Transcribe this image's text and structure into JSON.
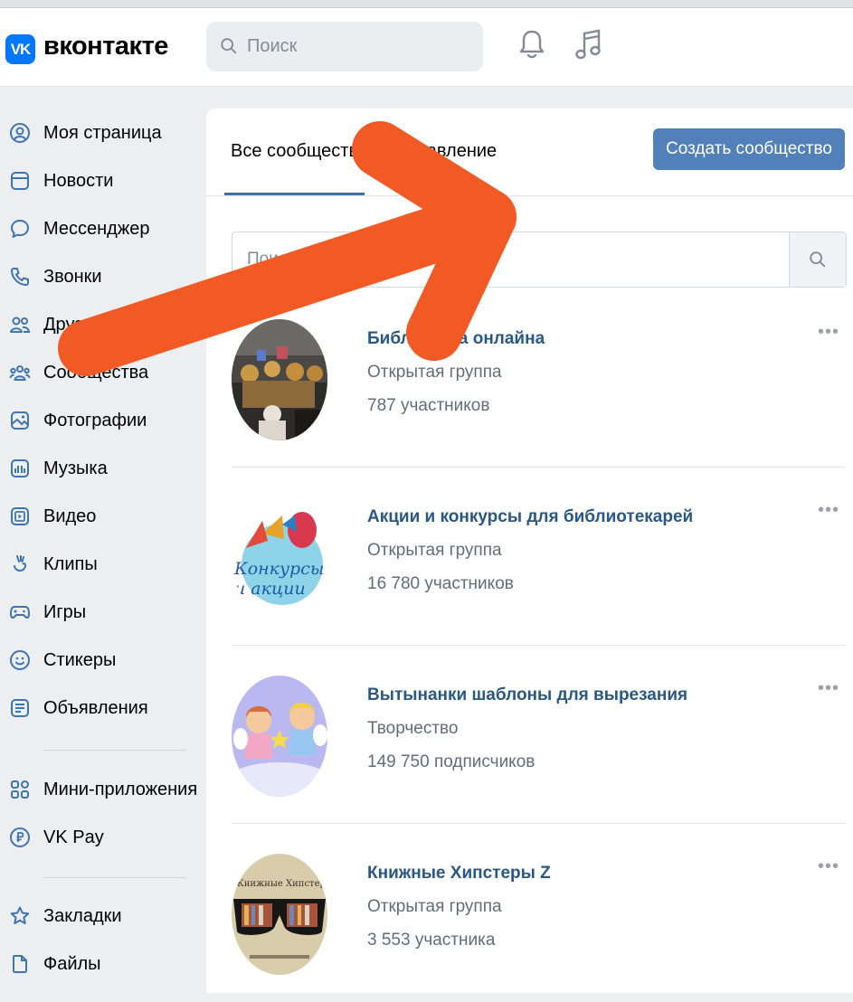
{
  "header": {
    "logo_mark": "VK",
    "logo_text": "вконтакте",
    "search_placeholder": "Поиск",
    "icons": [
      "bell-icon",
      "music-icon"
    ]
  },
  "sidebar": {
    "items": [
      {
        "label": "Моя страница",
        "icon": "profile-icon"
      },
      {
        "label": "Новости",
        "icon": "news-icon"
      },
      {
        "label": "Мессенджер",
        "icon": "messenger-icon"
      },
      {
        "label": "Звонки",
        "icon": "phone-icon"
      },
      {
        "label": "Друзья",
        "icon": "friends-icon"
      },
      {
        "label": "Сообщества",
        "icon": "communities-icon"
      },
      {
        "label": "Фотографии",
        "icon": "photos-icon"
      },
      {
        "label": "Музыка",
        "icon": "music-icon"
      },
      {
        "label": "Видео",
        "icon": "video-icon"
      },
      {
        "label": "Клипы",
        "icon": "clips-icon"
      },
      {
        "label": "Игры",
        "icon": "games-icon"
      },
      {
        "label": "Стикеры",
        "icon": "stickers-icon"
      },
      {
        "label": "Объявления",
        "icon": "ads-icon"
      },
      {
        "label": "Мини-приложения",
        "icon": "mini-apps-icon"
      },
      {
        "label": "VK Pay",
        "icon": "vkpay-icon"
      },
      {
        "label": "Закладки",
        "icon": "bookmarks-icon"
      },
      {
        "label": "Файлы",
        "icon": "files-icon"
      }
    ]
  },
  "main": {
    "tabs": [
      "Все сообщества",
      "Управление"
    ],
    "active_tab": "Все сообщества",
    "create_button": "Создать сообщество",
    "search_placeholder": "Поиск сообществ",
    "communities": [
      {
        "name": "Библиотека онлайна",
        "type": "Открытая группа",
        "count": "787 участников"
      },
      {
        "name": "Акции и конкурсы для библиотекарей",
        "type": "Открытая группа",
        "count": "16 780 участников"
      },
      {
        "name": "Вытынанки шаблоны для вырезания",
        "type": "Творчество",
        "count": "149 750 подписчиков"
      },
      {
        "name": "Книжные Хипстеры Z",
        "type": "Открытая группа",
        "count": "3 553 участника"
      }
    ],
    "more_glyph": "•••"
  },
  "avatar_texts": {
    "contests_logo": "Конкурсы и акции",
    "hipsters_logo": "Книжные Хипстеры"
  },
  "colors": {
    "vk_blue": "#0077ff",
    "button_blue": "#5181b8",
    "link_blue": "#2a5885",
    "arrow_orange": "#f15a24"
  }
}
